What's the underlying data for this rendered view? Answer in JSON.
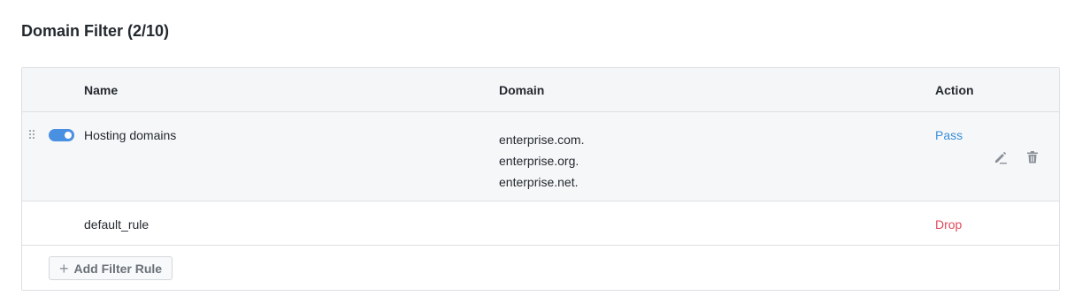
{
  "title": "Domain Filter (2/10)",
  "table": {
    "columns": {
      "name": "Name",
      "domain": "Domain",
      "action": "Action"
    },
    "rows": [
      {
        "enabled": true,
        "name": "Hosting domains",
        "domains": [
          "enterprise.com.",
          "enterprise.org.",
          "enterprise.net."
        ],
        "action": "Pass"
      },
      {
        "name": "default_rule",
        "action": "Drop"
      }
    ]
  },
  "add_button": {
    "icon": "+",
    "label": "Add Filter Rule"
  },
  "colors": {
    "accent": "#4a90e2",
    "pass": "#3b8fd9",
    "drop": "#e0495a"
  },
  "icons": [
    "drag-handle-icon",
    "edit-icon",
    "trash-icon",
    "plus-icon"
  ]
}
